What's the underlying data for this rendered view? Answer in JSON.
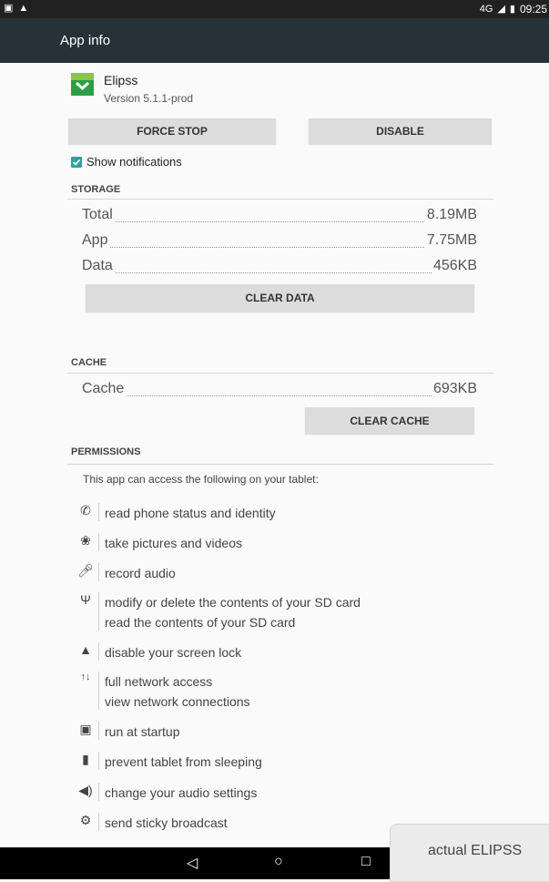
{
  "status_bar": {
    "network": "4G",
    "time": "09:25"
  },
  "app_bar": {
    "title": "App info"
  },
  "app": {
    "name": "Elipss",
    "version": "Version 5.1.1-prod",
    "icon_color": "#2e9e45"
  },
  "buttons": {
    "force_stop": "FORCE STOP",
    "disable": "DISABLE",
    "clear_data": "CLEAR DATA",
    "clear_cache": "CLEAR CACHE"
  },
  "notifications": {
    "label": "Show notifications",
    "checked": true,
    "accent": "#26a69a"
  },
  "storage": {
    "header": "STORAGE",
    "rows": [
      {
        "label": "Total",
        "value": "8.19MB"
      },
      {
        "label": "App",
        "value": "7.75MB"
      },
      {
        "label": "Data",
        "value": "456KB"
      }
    ]
  },
  "cache": {
    "header": "CACHE",
    "label": "Cache",
    "value": "693KB"
  },
  "permissions": {
    "header": "PERMISSIONS",
    "intro": "This app can access the following on your tablet:",
    "items": [
      {
        "icon": "phone-icon",
        "lines": [
          "read phone status and identity"
        ]
      },
      {
        "icon": "camera-icon",
        "lines": [
          "take pictures and videos"
        ]
      },
      {
        "icon": "microphone-icon",
        "lines": [
          "record audio"
        ]
      },
      {
        "icon": "usb-icon",
        "lines": [
          "modify or delete the contents of your SD card",
          "read the contents of your SD card"
        ]
      },
      {
        "icon": "lock-icon",
        "lines": [
          "disable your screen lock"
        ]
      },
      {
        "icon": "network-arrows-icon",
        "lines": [
          "full network access",
          "view network connections"
        ]
      },
      {
        "icon": "startup-icon",
        "lines": [
          "run at startup"
        ]
      },
      {
        "icon": "battery-icon",
        "lines": [
          "prevent tablet from sleeping"
        ]
      },
      {
        "icon": "speaker-icon",
        "lines": [
          "change your audio settings"
        ]
      },
      {
        "icon": "gear-icon",
        "lines": [
          "send sticky broadcast"
        ]
      }
    ]
  },
  "toast": {
    "text": "actual ELIPSS"
  },
  "colors": {
    "app_bar": "#263238",
    "status_bar": "#212121",
    "button_bg": "#dcdcdc"
  }
}
